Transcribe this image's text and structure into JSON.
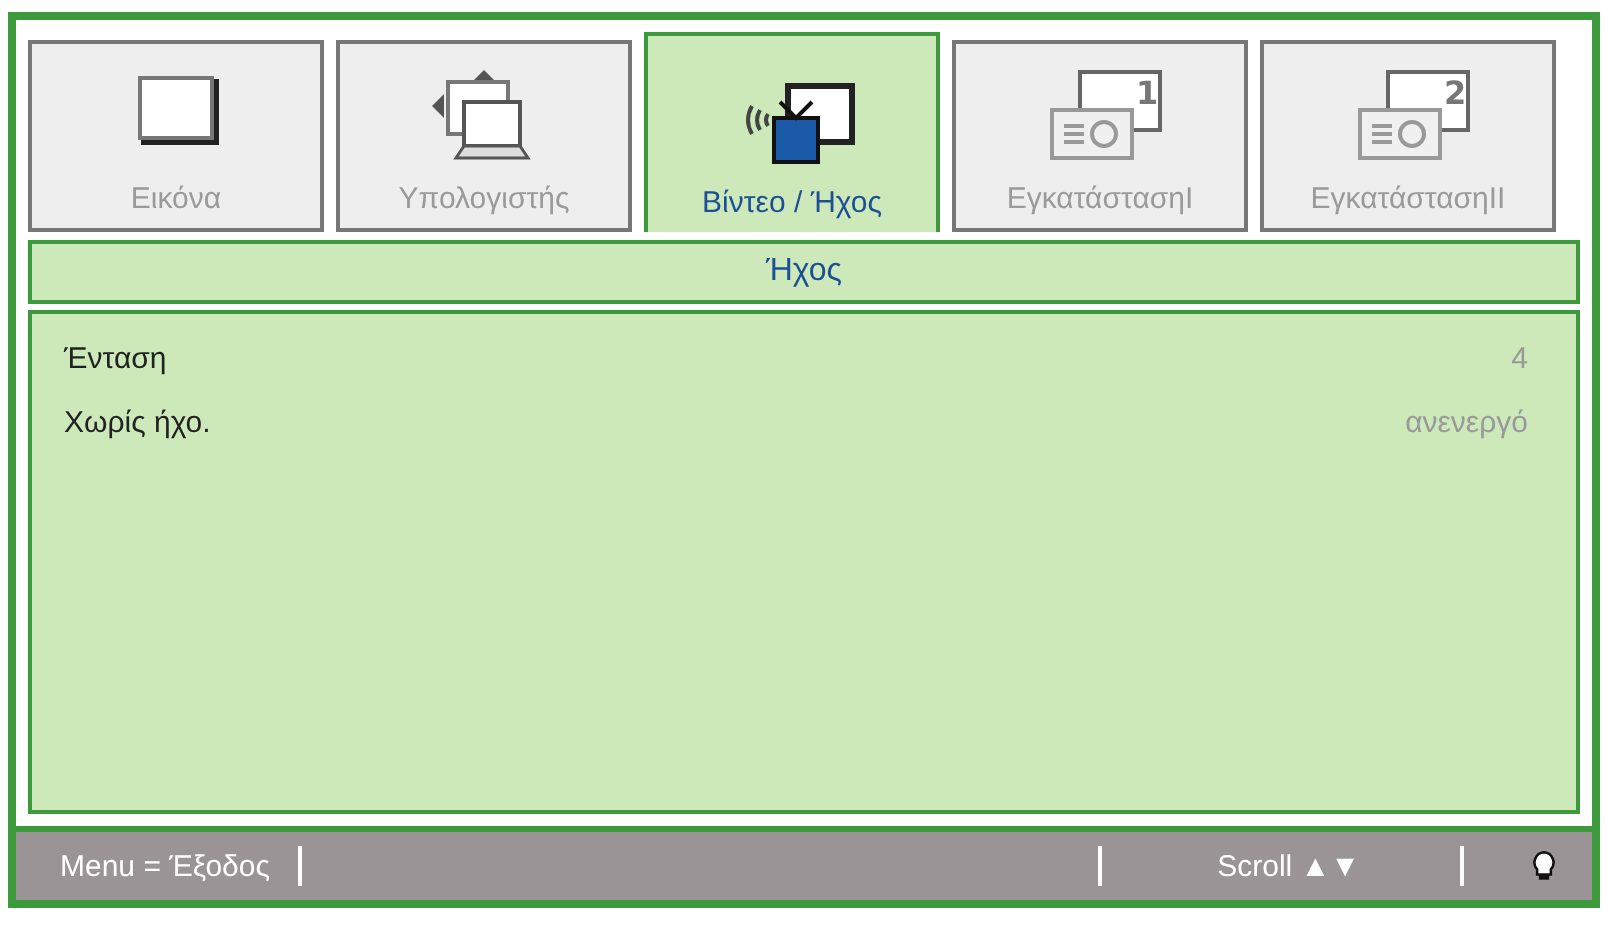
{
  "tabs": [
    {
      "label": "Εικόνα",
      "kind": "monitor",
      "selected": false
    },
    {
      "label": "Υπολογιστής",
      "kind": "computer",
      "selected": false
    },
    {
      "label": "Βίντεο / Ήχος",
      "kind": "video",
      "selected": true
    },
    {
      "label": "ΕγκατάστασηI",
      "kind": "projector",
      "badge": "1",
      "selected": false
    },
    {
      "label": "ΕγκατάστασηII",
      "kind": "projector",
      "badge": "2",
      "selected": false
    }
  ],
  "section_title": "Ήχος",
  "settings": [
    {
      "label": "Ένταση",
      "value": "4"
    },
    {
      "label": "Χωρίς ήχο.",
      "value": "ανενεργό"
    }
  ],
  "status_bar": {
    "exit_hint": "Menu = Έξοδος",
    "scroll_label": "Scroll",
    "scroll_arrows": "▲▼"
  }
}
